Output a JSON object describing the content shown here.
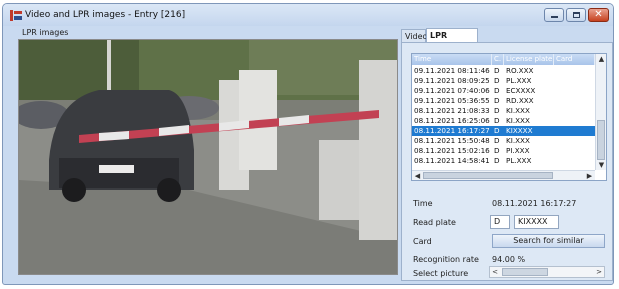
{
  "window": {
    "title": "Video and LPR images - Entry [216]",
    "minimize_icon": "minimize-icon",
    "maximize_icon": "maximize-icon",
    "close_icon": "close-icon",
    "close_glyph": "✕",
    "app_icon": "lpr-app-icon"
  },
  "left": {
    "section_label": "LPR images"
  },
  "tabs": [
    {
      "label": "Video"
    },
    {
      "label": "LPR images",
      "active": true
    }
  ],
  "table": {
    "columns": [
      "Time",
      "C.",
      "License plate",
      "Card"
    ],
    "rows": [
      {
        "time": "09.11.2021 08:11:46",
        "c": "D",
        "plate": "RO.XXX",
        "card": ""
      },
      {
        "time": "09.11.2021 08:09:25",
        "c": "D",
        "plate": "PL.XXX",
        "card": ""
      },
      {
        "time": "09.11.2021 07:40:06",
        "c": "D",
        "plate": "ECXXXX",
        "card": ""
      },
      {
        "time": "09.11.2021 05:36:55",
        "c": "D",
        "plate": "RD.XXX",
        "card": ""
      },
      {
        "time": "08.11.2021 21:08:33",
        "c": "D",
        "plate": "KI.XXX",
        "card": ""
      },
      {
        "time": "08.11.2021 16:25:06",
        "c": "D",
        "plate": "KI.XXX",
        "card": ""
      },
      {
        "time": "08.11.2021 16:17:27",
        "c": "D",
        "plate": "KIXXXX",
        "card": "",
        "selected": true
      },
      {
        "time": "08.11.2021 15:50:48",
        "c": "D",
        "plate": "KI.XXX",
        "card": ""
      },
      {
        "time": "08.11.2021 15:02:16",
        "c": "D",
        "plate": "PI.XXX",
        "card": ""
      },
      {
        "time": "08.11.2021 14:58:41",
        "c": "D",
        "plate": "PL.XXX",
        "card": ""
      }
    ],
    "scroll_up": "▲",
    "scroll_down": "▼",
    "scroll_left": "◀",
    "scroll_right": "▶"
  },
  "details": {
    "time_label": "Time",
    "time_value": "08.11.2021 16:17:27",
    "plate_label": "Read plate",
    "plate_country": "D",
    "plate_value": "KIXXXX",
    "card_label": "Card",
    "search_button": "Search for similar",
    "rate_label": "Recognition rate",
    "rate_value": "94.00 %",
    "picture_label": "Select picture",
    "picture_prev": "<",
    "picture_next": ">"
  },
  "colors": {
    "accent_selection": "#1f7bd1",
    "window_frame": "#c9daf0",
    "close_button": "#c6411f"
  }
}
